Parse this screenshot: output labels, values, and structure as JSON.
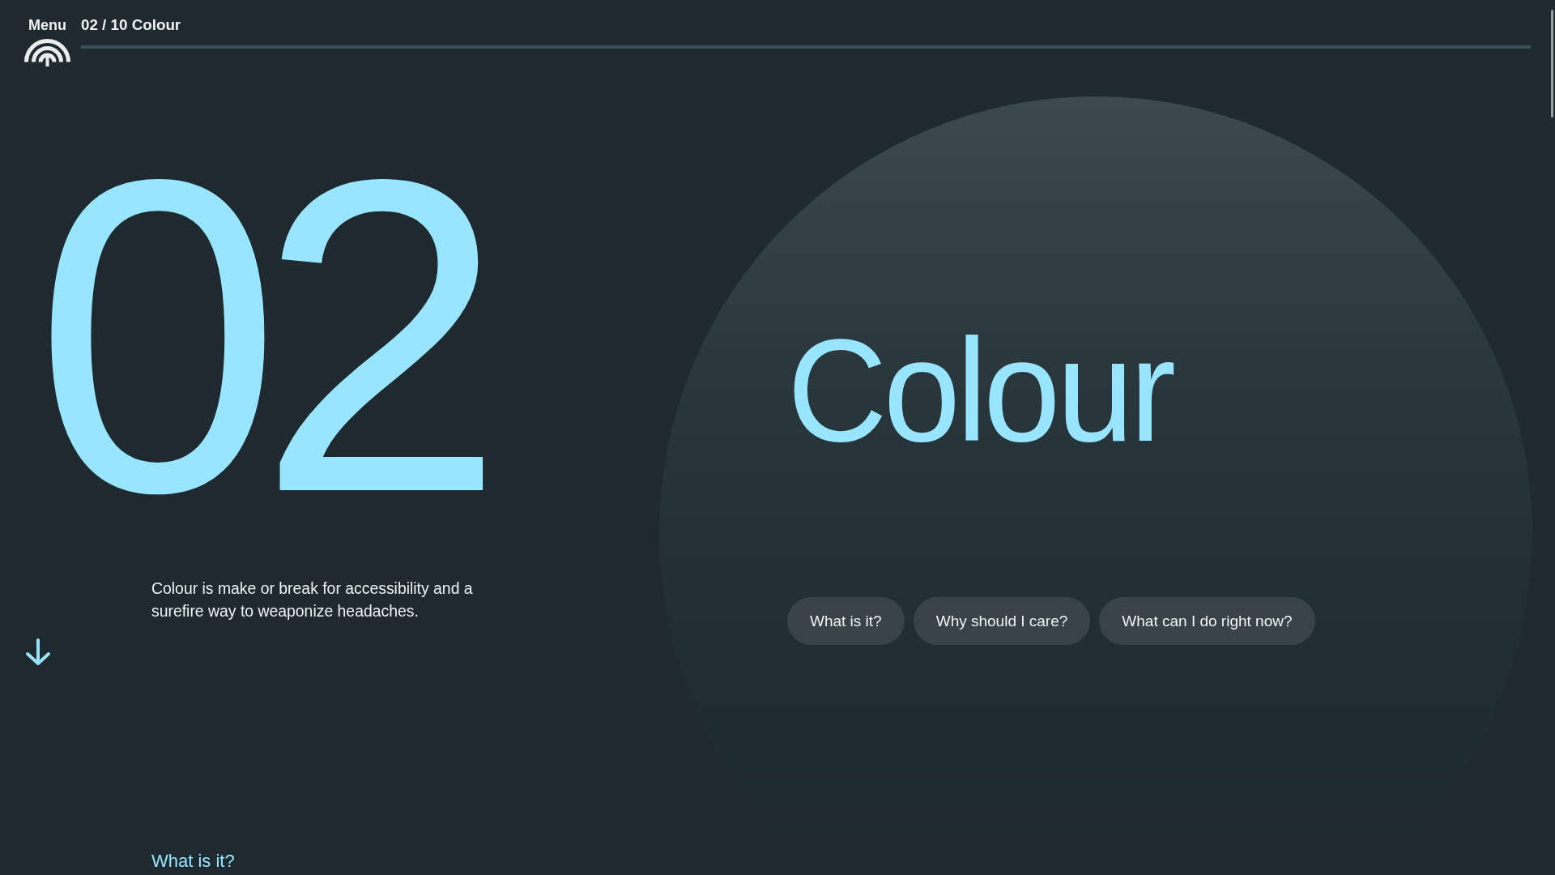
{
  "header": {
    "menu_label": "Menu",
    "breadcrumb": "02 / 10 Colour"
  },
  "hero": {
    "number": "02",
    "title": "Colour",
    "intro": "Colour is make or break for accessibility and a surefire way to weaponize headaches.",
    "buttons": [
      "What is it?",
      "Why should I care?",
      "What can I do right now?"
    ]
  },
  "next_section": {
    "heading": "What is it?"
  }
}
